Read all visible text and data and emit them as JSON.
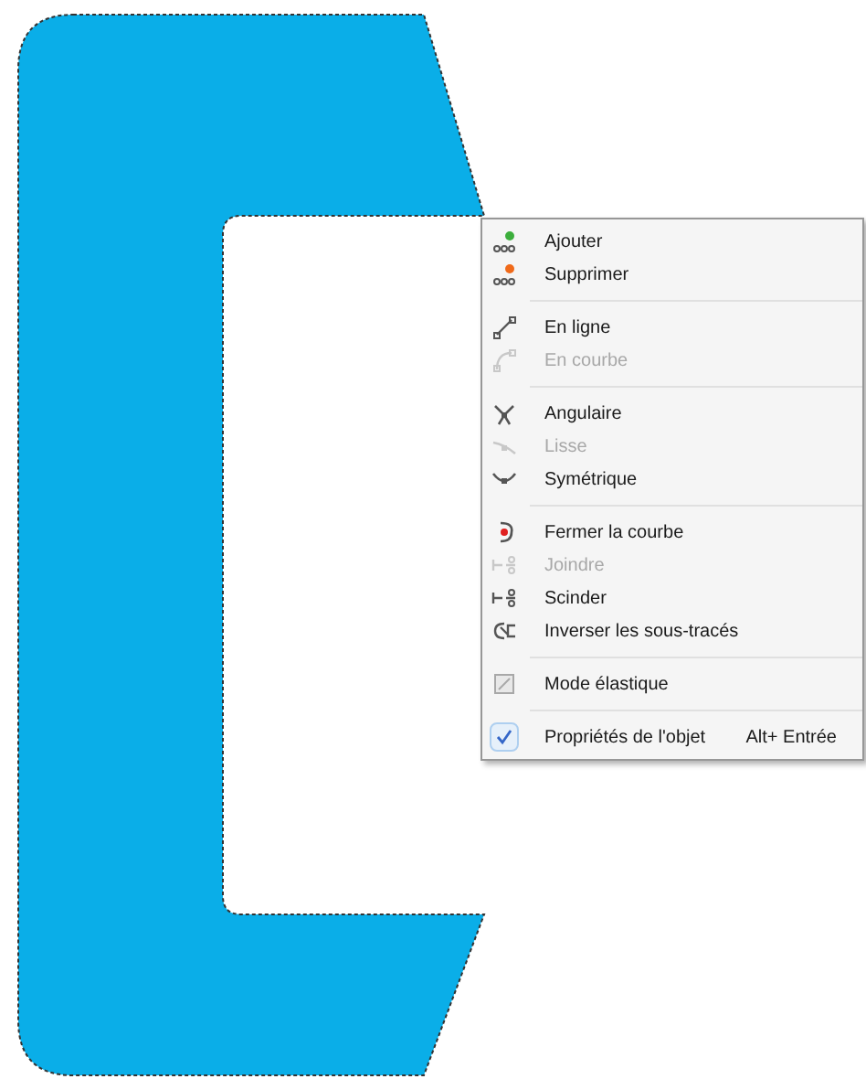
{
  "context_menu": {
    "items": [
      {
        "kind": "item",
        "label": "Ajouter",
        "disabled": false,
        "checked": false
      },
      {
        "kind": "item",
        "label": "Supprimer",
        "disabled": false,
        "checked": false
      },
      {
        "kind": "separator"
      },
      {
        "kind": "item",
        "label": "En ligne",
        "disabled": false,
        "checked": false
      },
      {
        "kind": "item",
        "label": "En courbe",
        "disabled": true,
        "checked": false
      },
      {
        "kind": "separator"
      },
      {
        "kind": "item",
        "label": "Angulaire",
        "disabled": false,
        "checked": false
      },
      {
        "kind": "item",
        "label": "Lisse",
        "disabled": true,
        "checked": false
      },
      {
        "kind": "item",
        "label": "Symétrique",
        "disabled": false,
        "checked": false
      },
      {
        "kind": "separator"
      },
      {
        "kind": "item",
        "label": "Fermer la courbe",
        "disabled": false,
        "checked": false
      },
      {
        "kind": "item",
        "label": "Joindre",
        "disabled": true,
        "checked": false
      },
      {
        "kind": "item",
        "label": "Scinder",
        "disabled": false,
        "checked": false
      },
      {
        "kind": "item",
        "label": "Inverser les sous-tracés",
        "disabled": false,
        "checked": false
      },
      {
        "kind": "separator"
      },
      {
        "kind": "item",
        "label": "Mode élastique",
        "disabled": false,
        "checked": false
      },
      {
        "kind": "separator"
      },
      {
        "kind": "item",
        "label": "Propriétés de l'objet",
        "shortcut": "Alt+ Entrée",
        "disabled": false,
        "checked": true
      }
    ]
  }
}
